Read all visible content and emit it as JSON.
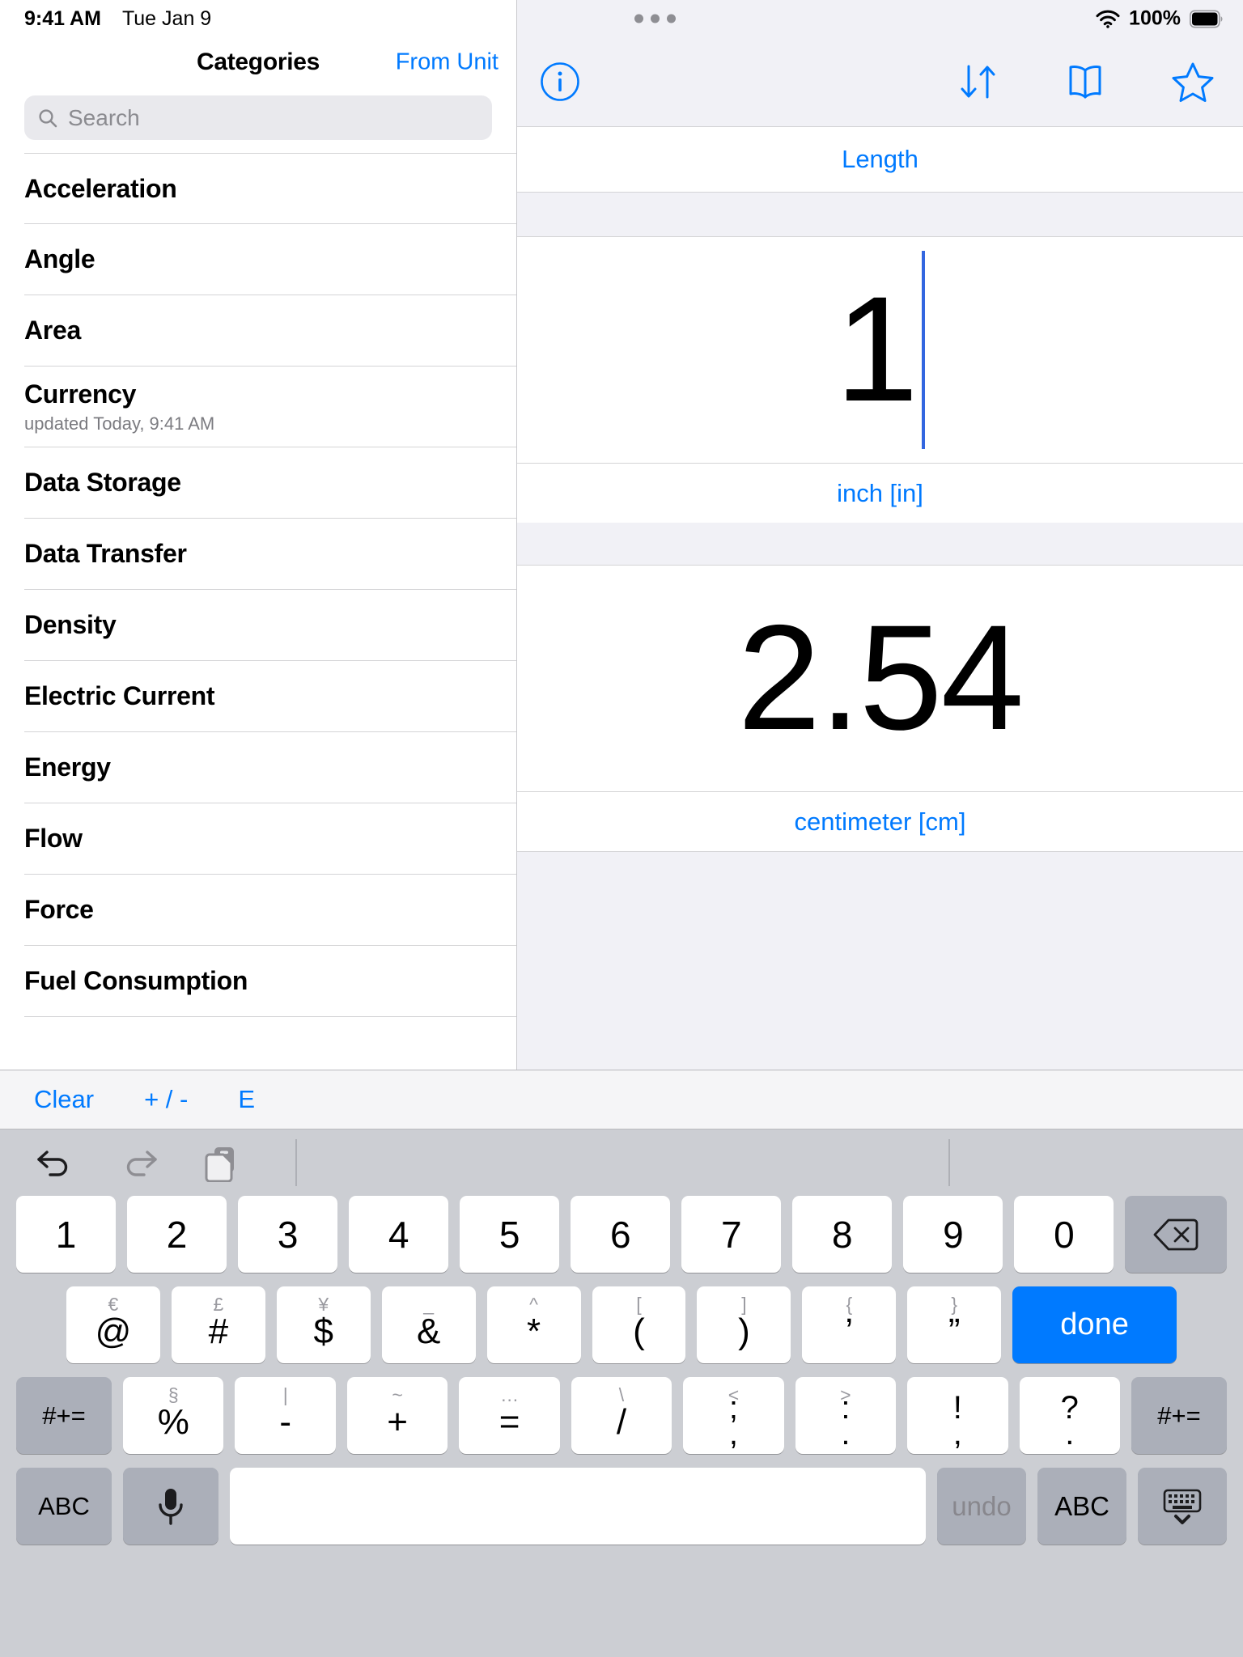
{
  "status_bar": {
    "time": "9:41 AM",
    "date": "Tue Jan 9",
    "battery_percent": "100%",
    "wifi_icon": "wifi-icon",
    "battery_icon": "battery-full-icon"
  },
  "sidebar": {
    "title": "Categories",
    "right_action": "From Unit",
    "search": {
      "placeholder": "Search",
      "value": "",
      "icon": "search-icon"
    },
    "categories": [
      {
        "label": "Acceleration",
        "subtitle": ""
      },
      {
        "label": "Angle",
        "subtitle": ""
      },
      {
        "label": "Area",
        "subtitle": ""
      },
      {
        "label": "Currency",
        "subtitle": "updated Today, 9:41 AM"
      },
      {
        "label": "Data Storage",
        "subtitle": ""
      },
      {
        "label": "Data Transfer",
        "subtitle": ""
      },
      {
        "label": "Density",
        "subtitle": ""
      },
      {
        "label": "Electric Current",
        "subtitle": ""
      },
      {
        "label": "Energy",
        "subtitle": ""
      },
      {
        "label": "Flow",
        "subtitle": ""
      },
      {
        "label": "Force",
        "subtitle": ""
      },
      {
        "label": "Fuel Consumption",
        "subtitle": ""
      }
    ]
  },
  "detail": {
    "toolbar": {
      "info_icon": "info-circle-icon",
      "swap_icon": "swap-arrows-icon",
      "book_icon": "book-icon",
      "favorite_icon": "star-outline-icon"
    },
    "category": "Length",
    "from": {
      "value": "1",
      "unit": "inch [in]"
    },
    "to": {
      "value": "2.54",
      "unit": "centimeter [cm]"
    }
  },
  "accessory_bar": {
    "clear": "Clear",
    "sign": "+ / -",
    "exponent": "E"
  },
  "keyboard": {
    "tools": {
      "undo_icon": "undo-arrow-icon",
      "redo_icon": "redo-arrow-icon",
      "paste_icon": "paste-icon"
    },
    "row1": [
      {
        "main": "1"
      },
      {
        "main": "2"
      },
      {
        "main": "3"
      },
      {
        "main": "4"
      },
      {
        "main": "5"
      },
      {
        "main": "6"
      },
      {
        "main": "7"
      },
      {
        "main": "8"
      },
      {
        "main": "9"
      },
      {
        "main": "0"
      }
    ],
    "backspace_icon": "backspace-icon",
    "row2": [
      {
        "hint": "€",
        "main": "@"
      },
      {
        "hint": "£",
        "main": "#"
      },
      {
        "hint": "¥",
        "main": "$"
      },
      {
        "hint": "_",
        "main": "&"
      },
      {
        "hint": "^",
        "main": "*"
      },
      {
        "hint": "[",
        "main": "("
      },
      {
        "hint": "]",
        "main": ")"
      },
      {
        "hint": "{",
        "main": "’"
      },
      {
        "hint": "}",
        "main": "”"
      }
    ],
    "done_label": "done",
    "row3_shift_left": "#+=",
    "row3": [
      {
        "hint": "§",
        "main": "%"
      },
      {
        "hint": "|",
        "main": "-"
      },
      {
        "hint": "~",
        "main": "+"
      },
      {
        "hint": "…",
        "main": "="
      },
      {
        "hint": "\\",
        "main": "/"
      },
      {
        "hint": "<",
        "top": ";",
        "bottom": ","
      },
      {
        "hint": ">",
        "top": ":",
        "bottom": "."
      },
      {
        "hint": "",
        "top": "!",
        "bottom": ","
      },
      {
        "hint": "",
        "top": "?",
        "bottom": "."
      }
    ],
    "row3_shift_right": "#+=",
    "row4": {
      "abc_left": "ABC",
      "mic_icon": "microphone-icon",
      "space": "",
      "undo": "undo",
      "abc_right": "ABC",
      "dismiss_icon": "hide-keyboard-icon"
    }
  },
  "colors": {
    "accent": "#007aff",
    "caret": "#3366e0",
    "keyboard_bg": "#ccced3",
    "key_dark": "#abafb9",
    "panel_bg": "#f1f1f6"
  }
}
